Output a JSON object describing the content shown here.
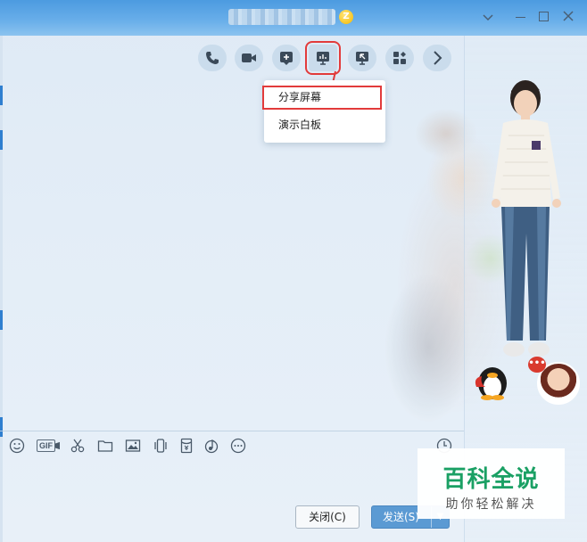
{
  "titlebar": {
    "vip_badge": "Z",
    "controls": [
      "chevron-down",
      "minimize",
      "maximize",
      "close"
    ]
  },
  "toolbar": {
    "buttons": [
      {
        "icon": "phone-icon"
      },
      {
        "icon": "video-icon"
      },
      {
        "icon": "add-app-icon"
      },
      {
        "icon": "presentation-icon",
        "highlighted": true
      },
      {
        "icon": "remote-screen-icon"
      },
      {
        "icon": "apps-grid-icon"
      },
      {
        "icon": "chevron-right-icon"
      }
    ]
  },
  "dropdown": {
    "items": [
      {
        "label": "分享屏幕",
        "selected": true
      },
      {
        "label": "演示白板",
        "selected": false
      }
    ]
  },
  "input_toolbar": {
    "gif_label": "GIF",
    "tools": [
      "emoji-icon",
      "gif-icon",
      "scissors-icon",
      "folder-icon",
      "image-icon",
      "shake-icon",
      "red-packet-icon",
      "music-icon",
      "more-icon"
    ]
  },
  "bottom": {
    "close_label": "关闭(C)",
    "send_label": "发送(S)"
  },
  "watermark": {
    "main": "百科全说",
    "sub": "助你轻松解决"
  },
  "colors": {
    "highlight_red": "#e23b3b",
    "send_blue": "#5b9ad3",
    "watermark_green": "#1aa064"
  }
}
